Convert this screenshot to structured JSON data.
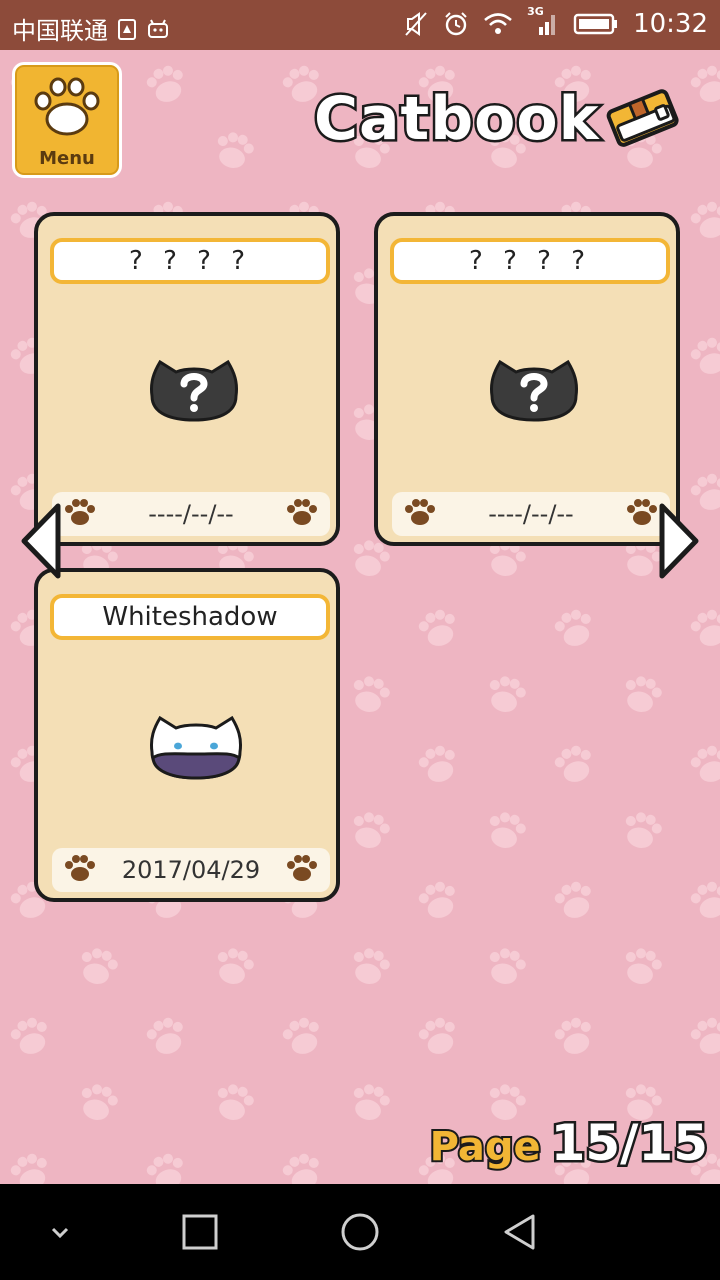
{
  "status_bar": {
    "carrier": "中国联通",
    "time": "10:32",
    "network": "3G",
    "icons": [
      "sim-warning-icon",
      "android-icon",
      "mute-icon",
      "alarm-icon",
      "wifi-icon",
      "signal-icon",
      "battery-icon"
    ]
  },
  "header": {
    "menu_label": "Menu",
    "title": "Catbook"
  },
  "cards": [
    {
      "name": "? ? ? ?",
      "date": "----/--/--",
      "discovered": false
    },
    {
      "name": "? ? ? ?",
      "date": "----/--/--",
      "discovered": false
    },
    {
      "name": "Whiteshadow",
      "date": "2017/04/29",
      "discovered": true
    }
  ],
  "pager": {
    "label": "Page",
    "value": "15/15"
  },
  "nav_bar": {
    "icons": [
      "collapse-icon",
      "recents-icon",
      "home-icon",
      "back-icon"
    ]
  },
  "colors": {
    "background": "#eeb5c2",
    "card": "#f4dfb6",
    "accent": "#f2b635",
    "status_bar": "#8d4b3a"
  }
}
